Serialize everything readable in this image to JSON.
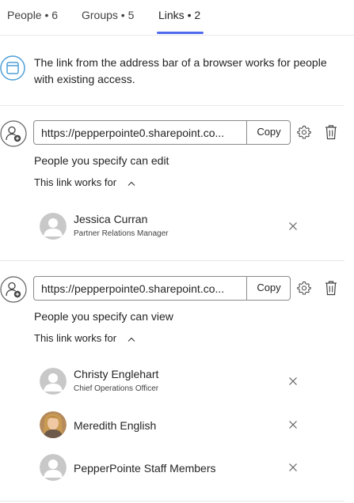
{
  "tabs": [
    {
      "label": "People • 6"
    },
    {
      "label": "Groups • 5"
    },
    {
      "label": "Links • 2"
    }
  ],
  "active_tab": "Links • 2",
  "accent_color": "#4f6bed",
  "info": {
    "text": "The link from the address bar of a browser works for people with existing access.",
    "icon": "browser-window-icon"
  },
  "links": [
    {
      "url": "https://pepperpointe0.sharepoint.co...",
      "copy_label": "Copy",
      "permission": "People you specify can edit",
      "works_for_label": "This link works for",
      "people": [
        {
          "name": "Jessica Curran",
          "role": "Partner Relations Manager",
          "avatar": "placeholder-person-icon"
        }
      ]
    },
    {
      "url": "https://pepperpointe0.sharepoint.co...",
      "copy_label": "Copy",
      "permission": "People you specify can view",
      "works_for_label": "This link works for",
      "people": [
        {
          "name": "Christy Englehart",
          "role": "Chief Operations Officer",
          "avatar": "placeholder-person-icon"
        },
        {
          "name": "Meredith English",
          "role": "",
          "avatar": "photo-avatar"
        },
        {
          "name": "PepperPointe Staff Members",
          "role": "",
          "avatar": "placeholder-person-icon"
        }
      ]
    }
  ]
}
